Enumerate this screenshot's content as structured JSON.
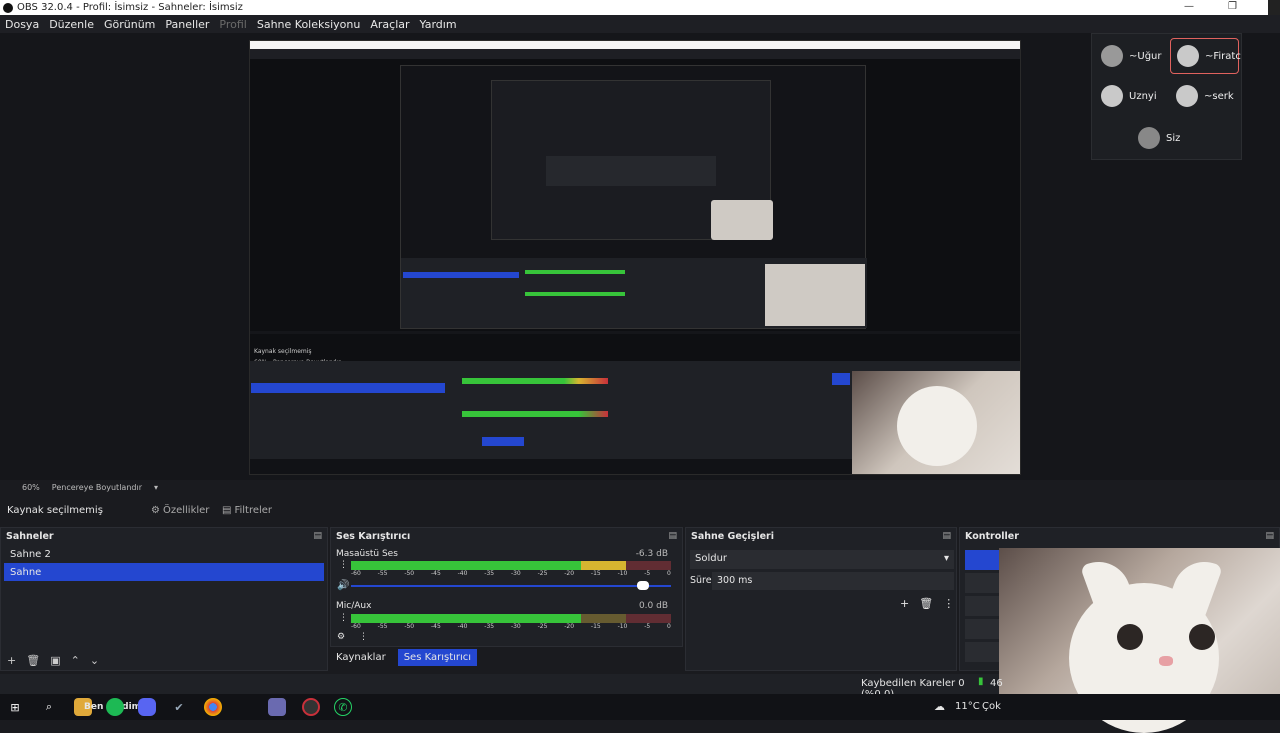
{
  "window": {
    "title": "OBS 32.0.4 - Profil: İsimsiz - Sahneler: İsimsiz"
  },
  "menu": [
    "Dosya",
    "Düzenle",
    "Görünüm",
    "Paneller",
    "Profil",
    "Sahne Koleksiyonu",
    "Araçlar",
    "Yardım"
  ],
  "call": {
    "participants": [
      {
        "name": "~Uğur",
        "active": false
      },
      {
        "name": "~Firatc",
        "active": true
      },
      {
        "name": "Uznyi",
        "active": false
      },
      {
        "name": "~serk",
        "active": false
      }
    ],
    "self": "Siz"
  },
  "zoom": {
    "level": "60%",
    "mode": "Pencereye Boyutlandır"
  },
  "source_bar": {
    "label": "Kaynak seçilmemiş",
    "properties": "Özellikler",
    "filters": "Filtreler"
  },
  "scenes": {
    "title": "Sahneler",
    "items": [
      "Sahne 2",
      "Sahne"
    ],
    "selected": 1
  },
  "mixer": {
    "title": "Ses Karıştırıcı",
    "channels": [
      {
        "name": "Masaüstü Ses",
        "db": "-6.3 dB",
        "level": 0.78,
        "volume": 0.93
      },
      {
        "name": "Mic/Aux",
        "db": "0.0 dB",
        "level": 0.68,
        "volume": 1.0
      }
    ],
    "ticks": [
      "-60",
      "-55",
      "-50",
      "-45",
      "-40",
      "-35",
      "-30",
      "-25",
      "-20",
      "-15",
      "-10",
      "-5",
      "0"
    ]
  },
  "transitions": {
    "title": "Sahne Geçişleri",
    "type": "Soldur",
    "duration_label": "Süre",
    "duration": "300 ms"
  },
  "controls": {
    "title": "Kontroller"
  },
  "tabs": {
    "sources": "Kaynaklar",
    "mixer": "Ses Karıştırıcı"
  },
  "status": {
    "dropped": "Kaybedilen Kareler 0 (%0.0)",
    "net": "46"
  },
  "taskbar": {
    "greeting": "Ben geldim",
    "weather": "11°C",
    "weather_text": "Çok"
  },
  "colors": {
    "accent": "#2447d0",
    "meter_green": "#37c43a",
    "meter_yellow": "#d7b530",
    "meter_red": "#c8303a",
    "active_tile": "#e0625e"
  }
}
